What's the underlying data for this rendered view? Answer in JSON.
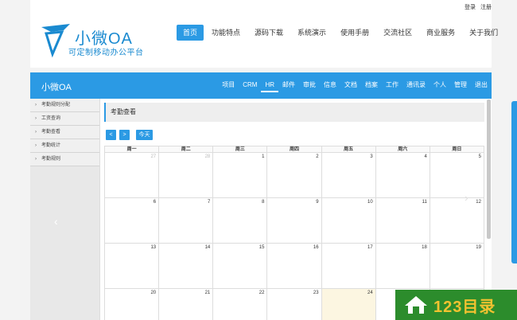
{
  "top_links": [
    "登录",
    "注册"
  ],
  "logo": {
    "title": "小微OA",
    "subtitle": "可定制移动办公平台"
  },
  "site_nav": [
    "首页",
    "功能特点",
    "源码下载",
    "系统演示",
    "使用手册",
    "交流社区",
    "商业服务",
    "关于我们"
  ],
  "site_nav_active": 0,
  "app": {
    "name": "小微OA",
    "nav": [
      "项目",
      "CRM",
      "HR",
      "邮件",
      "审批",
      "信息",
      "文档",
      "档案",
      "工作",
      "通讯录",
      "个人",
      "管理",
      "退出"
    ],
    "nav_active": 2,
    "sidebar": [
      "考勤规则分配",
      "工资查询",
      "考勤查看",
      "考勤统计",
      "考勤规则"
    ],
    "panel_title": "考勤查看",
    "buttons": {
      "prev": "<",
      "next": ">",
      "today": "今天"
    },
    "weekdays": [
      "周一",
      "周二",
      "周三",
      "周四",
      "周五",
      "周六",
      "周日"
    ],
    "weeks": [
      [
        {
          "d": "27",
          "o": true
        },
        {
          "d": "28",
          "o": true
        },
        {
          "d": "1"
        },
        {
          "d": "2"
        },
        {
          "d": "3"
        },
        {
          "d": "4"
        },
        {
          "d": "5"
        }
      ],
      [
        {
          "d": "6"
        },
        {
          "d": "7"
        },
        {
          "d": "8"
        },
        {
          "d": "9"
        },
        {
          "d": "10"
        },
        {
          "d": "11"
        },
        {
          "d": "12"
        }
      ],
      [
        {
          "d": "13"
        },
        {
          "d": "14"
        },
        {
          "d": "15"
        },
        {
          "d": "16"
        },
        {
          "d": "17"
        },
        {
          "d": "18"
        },
        {
          "d": "19"
        }
      ],
      [
        {
          "d": "20"
        },
        {
          "d": "21"
        },
        {
          "d": "22"
        },
        {
          "d": "23"
        },
        {
          "d": "24",
          "t": true
        },
        {
          "d": "25"
        },
        {
          "d": "26"
        }
      ]
    ]
  },
  "watermark": "123目录",
  "colors": {
    "accent": "#2b9ae4",
    "today_bg": "#fcf6e1",
    "watermark_bg": "#2c8c2c",
    "watermark_text": "#f2c230"
  }
}
